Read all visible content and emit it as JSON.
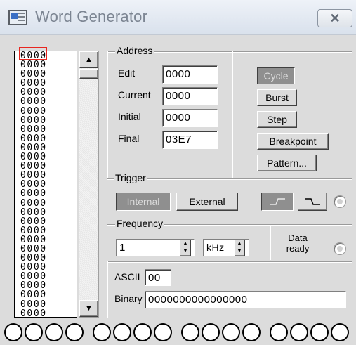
{
  "window": {
    "title": "Word Generator",
    "close_glyph": "✕",
    "icon": "word-generator-app-icon"
  },
  "word_list": {
    "words": [
      "0000",
      "0000",
      "0000",
      "0000",
      "0000",
      "0000",
      "0000",
      "0000",
      "0000",
      "0000",
      "0000",
      "0000",
      "0000",
      "0000",
      "0000",
      "0000",
      "0000",
      "0000",
      "0000",
      "0000",
      "0000",
      "0000",
      "0000",
      "0000",
      "0000",
      "0000",
      "0000",
      "0000",
      "0000"
    ],
    "highlight_color": "#e8261f"
  },
  "address": {
    "group_label": "Address",
    "edit_label": "Edit",
    "edit_value": "0000",
    "current_label": "Current",
    "current_value": "0000",
    "initial_label": "Initial",
    "initial_value": "0000",
    "final_label": "Final",
    "final_value": "03E7"
  },
  "mode_buttons": {
    "cycle": "Cycle",
    "burst": "Burst",
    "step": "Step",
    "breakpoint": "Breakpoint",
    "pattern": "Pattern..."
  },
  "trigger": {
    "group_label": "Trigger",
    "internal": "Internal",
    "external": "External",
    "rising_edge_icon": "rising-edge-icon",
    "falling_edge_icon": "falling-edge-icon"
  },
  "frequency": {
    "group_label": "Frequency",
    "value": "1",
    "unit": "kHz",
    "data_ready_label_line1": "Data",
    "data_ready_label_line2": "ready"
  },
  "ascii": {
    "label": "ASCII",
    "value": "00"
  },
  "binary": {
    "label": "Binary",
    "value": "0000000000000000"
  },
  "outputs": {
    "count": 16
  }
}
